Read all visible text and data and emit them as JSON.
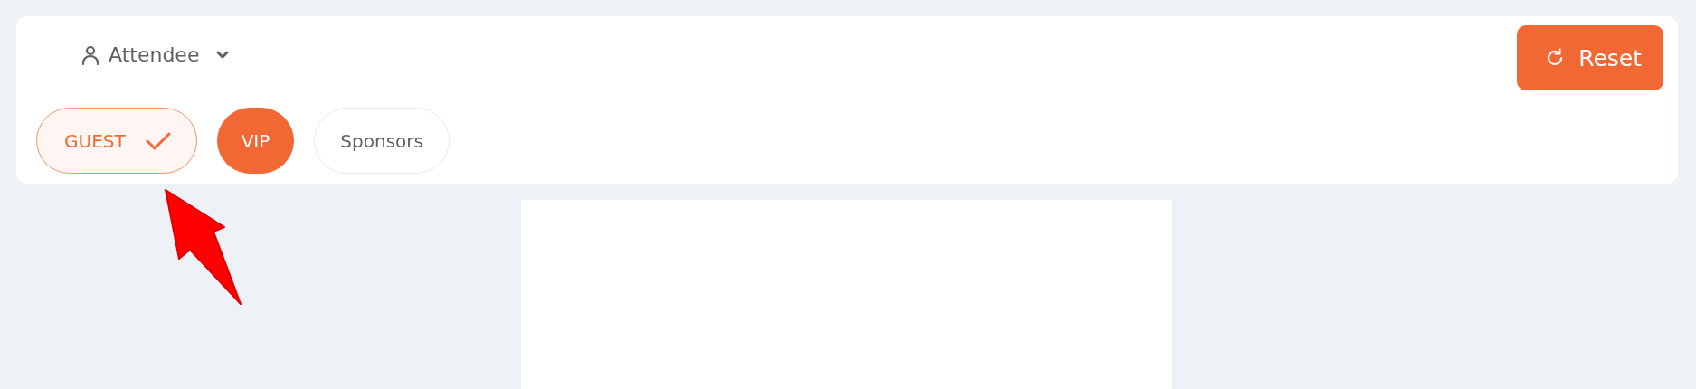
{
  "role_dropdown": {
    "label": "Attendee"
  },
  "reset_button": {
    "label": "Reset"
  },
  "chips": [
    {
      "label": "GUEST",
      "checked": true,
      "selected": false
    },
    {
      "label": "VIP",
      "checked": false,
      "selected": true
    },
    {
      "label": "Sponsors",
      "checked": false,
      "selected": false
    }
  ]
}
